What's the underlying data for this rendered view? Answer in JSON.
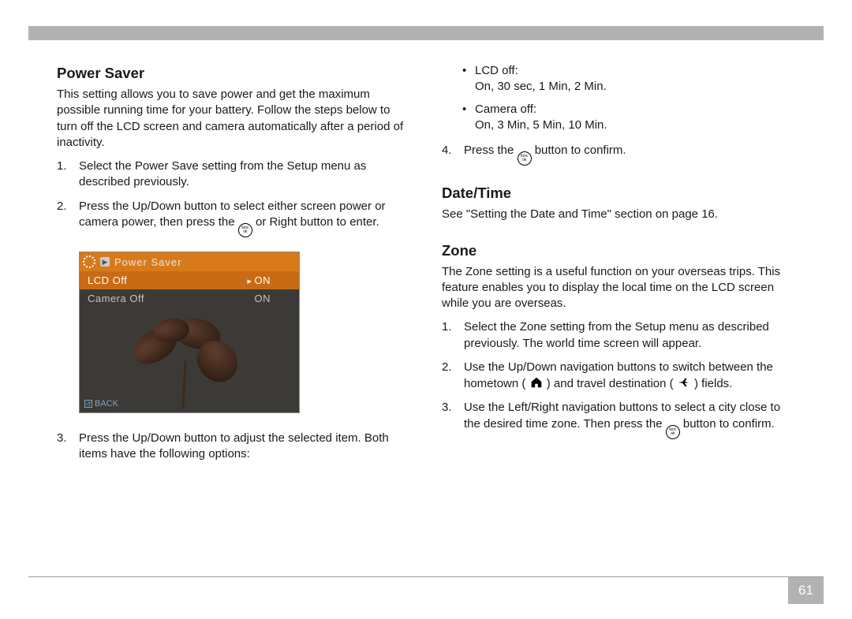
{
  "page_number": "61",
  "left": {
    "heading_power": "Power Saver",
    "power_intro": "This setting allows you to save power and get the maximum possible running time for your battery. Follow the steps below to turn off the LCD screen and camera automatically after a period of inactivity.",
    "step1": "Select the Power Save setting from the Setup menu as described previously.",
    "step2a": "Press the Up/Down button to select either screen power or camera power, then press the ",
    "step2b": " or Right button to enter.",
    "step3": "Press the Up/Down button to adjust the selected item. Both items have the following options:",
    "screenshot": {
      "title": "Power Saver",
      "row1_label": "LCD Off",
      "row1_value": "ON",
      "row2_label": "Camera Off",
      "row2_value": "ON",
      "back": "BACK"
    }
  },
  "right": {
    "bullet_lcd_a": "LCD off:",
    "bullet_lcd_b": "On, 30 sec, 1 Min, 2 Min.",
    "bullet_cam_a": "Camera off:",
    "bullet_cam_b": "On, 3 Min, 5 Min, 10 Min.",
    "step4a": "Press the ",
    "step4b": " button to confirm.",
    "heading_date": "Date/Time",
    "date_text": "See \"Setting the Date and Time\" section on page 16.",
    "heading_zone": "Zone",
    "zone_intro": "The Zone setting is a useful function on your overseas trips. This feature enables you to display the local time on the LCD screen while you are overseas.",
    "z1": "Select the Zone setting from the Setup menu as described previously. The world time screen will appear.",
    "z2a": "Use the Up/Down navigation buttons to switch between the hometown ( ",
    "z2b": " ) and travel destination ( ",
    "z2c": " ) fields.",
    "z3a": "Use the Left/Right navigation buttons to select a city close to the desired time zone. Then press the ",
    "z3b": " button to confirm."
  },
  "icons": {
    "func_top": "func",
    "func_bot": "ok"
  }
}
